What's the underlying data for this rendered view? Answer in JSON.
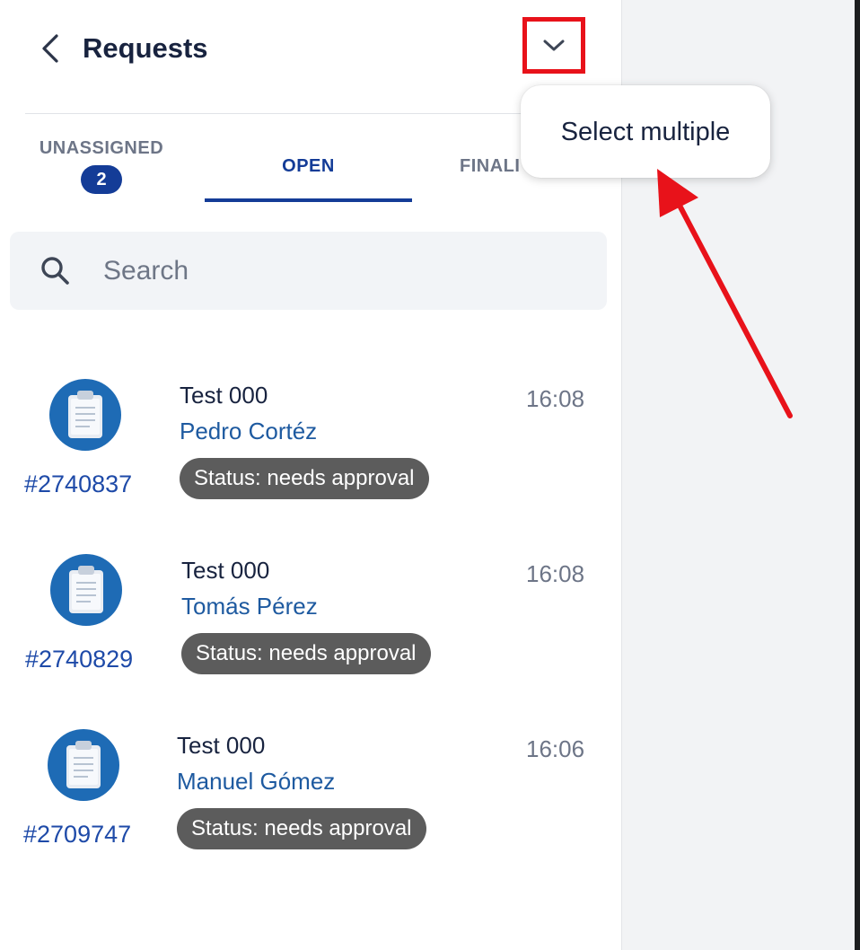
{
  "header": {
    "title": "Requests",
    "back_icon": "chevron-left-icon",
    "dropdown_icon": "chevron-down-icon"
  },
  "tabs": [
    {
      "label": "UNASSIGNED",
      "badge": "2"
    },
    {
      "label": "OPEN",
      "active": true
    },
    {
      "label": "FINALI"
    }
  ],
  "search": {
    "placeholder": "Search",
    "value": "",
    "icon": "search-icon"
  },
  "requests": [
    {
      "id": "#2740837",
      "title": "Test 000",
      "name": "Pedro Cortéz",
      "status": "Status: needs approval",
      "time": "16:08",
      "icon": "clipboard-icon"
    },
    {
      "id": "#2740829",
      "title": "Test 000",
      "name": "Tomás Pérez",
      "status": "Status: needs approval",
      "time": "16:08",
      "icon": "clipboard-icon"
    },
    {
      "id": "#2709747",
      "title": "Test 000",
      "name": "Manuel Gómez",
      "status": "Status: needs approval",
      "time": "16:06",
      "icon": "clipboard-icon"
    }
  ],
  "popup_menu": {
    "items": [
      "Select multiple"
    ]
  },
  "colors": {
    "accent": "#143c97",
    "highlight": "#e8121a",
    "status_badge": "#5c5c5c",
    "avatar": "#1e6bb5"
  }
}
